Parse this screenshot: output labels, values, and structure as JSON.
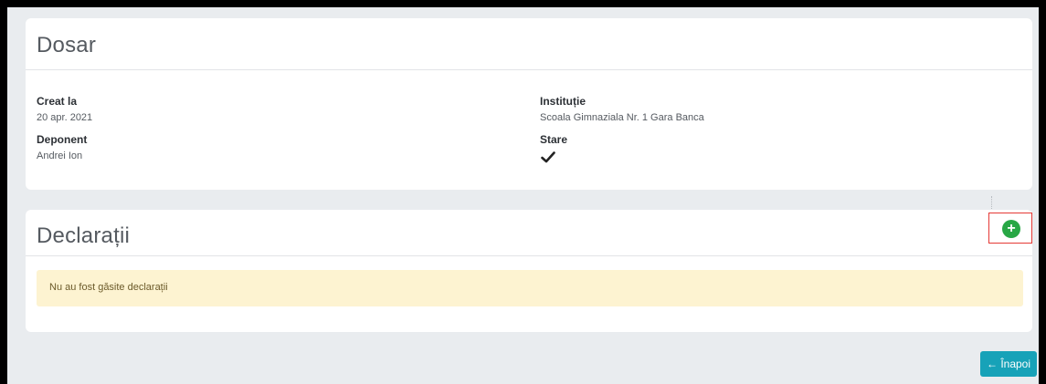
{
  "dosar": {
    "title": "Dosar",
    "created_label": "Creat la",
    "created_value": "20 apr. 2021",
    "institution_label": "Instituție",
    "institution_value": "Scoala Gimnaziala Nr. 1 Gara Banca",
    "depositor_label": "Deponent",
    "depositor_value": "Andrei Ion",
    "status_label": "Stare",
    "status_icon": "checkmark-icon"
  },
  "declaratii": {
    "title": "Declarații",
    "add_icon_glyph": "+",
    "empty_message": "Nu au fost găsite declarații"
  },
  "footer": {
    "back_label": "← Înapoi"
  },
  "colors": {
    "add_button": "#28a745",
    "back_button": "#17a2b8",
    "alert_bg": "#fdf3d1",
    "highlight": "#e53935"
  }
}
